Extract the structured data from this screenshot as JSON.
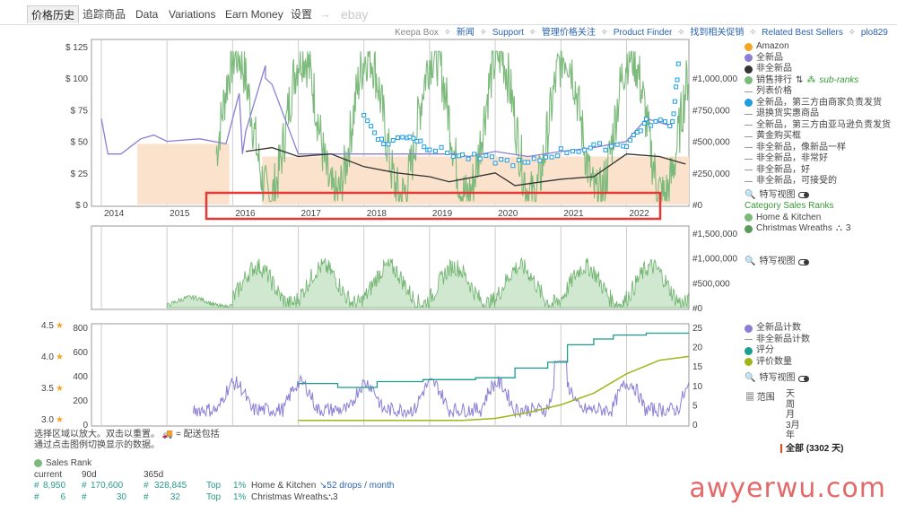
{
  "tabs": {
    "items": [
      "价格历史",
      "追踪商品",
      "Data",
      "Variations",
      "Earn Money",
      "设置",
      "→",
      "ebay"
    ]
  },
  "linkbar": {
    "keepa_box": "Keepa Box",
    "items": [
      "新闻",
      "Support",
      "管理价格关注",
      "Product Finder",
      "找到相关促销",
      "Related Best Sellers",
      "plo829"
    ],
    "sep": "✧"
  },
  "colors": {
    "amazon": "#f5a623",
    "new": "#8a7fd6",
    "used": "#333333",
    "sales_rank": "#7cba7c",
    "new_3rd_fba": "#1e9de0",
    "review_rating": "#1a9e8e",
    "review_count": "#a2b41a",
    "fill_orange": "#fbe2cc",
    "highlight": "#e53935"
  },
  "chart_data": [
    {
      "type": "line",
      "name": "main",
      "x_ticks": [
        "2014",
        "2015",
        "2016",
        "2017",
        "2018",
        "2019",
        "2020",
        "2021",
        "2022"
      ],
      "y_left_ticks": [
        "$ 0",
        "$ 25",
        "$ 50",
        "$ 75",
        "$ 100",
        "$ 125"
      ],
      "y_right_ticks": [
        "#0",
        "#250,000",
        "#500,000",
        "#750,000",
        "#1,000,000"
      ],
      "ylim_left": [
        0,
        125
      ],
      "ylim_right": [
        0,
        1250000
      ],
      "series": [
        {
          "name": "全新品",
          "values": [
            [
              2014.0,
              68
            ],
            [
              2014.1,
              40
            ],
            [
              2014.3,
              40
            ],
            [
              2014.6,
              52
            ],
            [
              2014.8,
              55
            ],
            [
              2015.0,
              50
            ],
            [
              2015.5,
              52
            ],
            [
              2015.9,
              48
            ],
            [
              2016.1,
              88
            ],
            [
              2016.15,
              40
            ],
            [
              2016.2,
              58
            ],
            [
              2016.5,
              110
            ],
            [
              2016.5,
              100
            ],
            [
              2016.6,
              95
            ],
            [
              2017.0,
              40
            ],
            [
              2018.5,
              40
            ],
            [
              2019.4,
              40
            ],
            [
              2019.6,
              38
            ],
            [
              2020.0,
              42
            ],
            [
              2020.5,
              38
            ],
            [
              2021.0,
              42
            ],
            [
              2021.5,
              45
            ],
            [
              2022.0,
              50
            ],
            [
              2022.3,
              68
            ],
            [
              2022.7,
              62
            ]
          ]
        },
        {
          "name": "非全新品",
          "values": [
            [
              2016.2,
              42
            ],
            [
              2016.6,
              45
            ],
            [
              2017.0,
              38
            ],
            [
              2017.5,
              40
            ],
            [
              2018.0,
              30
            ],
            [
              2018.5,
              25
            ],
            [
              2019.0,
              22
            ],
            [
              2019.3,
              18
            ],
            [
              2020.0,
              25
            ],
            [
              2020.3,
              15
            ],
            [
              2021.0,
              20
            ],
            [
              2021.5,
              22
            ],
            [
              2022.0,
              40
            ],
            [
              2022.5,
              38
            ],
            [
              2022.9,
              32
            ]
          ]
        },
        {
          "name": "全新品，第三方由商家负责发货",
          "values": [
            [
              2018.0,
              70
            ],
            [
              2018.3,
              48
            ],
            [
              2018.7,
              55
            ],
            [
              2019.0,
              45
            ],
            [
              2019.5,
              38
            ],
            [
              2020.0,
              35
            ],
            [
              2020.5,
              32
            ],
            [
              2021.0,
              42
            ],
            [
              2021.5,
              45
            ],
            [
              2022.0,
              48
            ],
            [
              2022.3,
              65
            ],
            [
              2022.7,
              65
            ],
            [
              2022.8,
              115
            ]
          ]
        }
      ],
      "highlight_box": {
        "from": "2016",
        "to": "2022"
      }
    },
    {
      "type": "area",
      "name": "category_sales_ranks",
      "y_right_ticks": [
        "#0",
        "#500,000",
        "#1,000,000",
        "#1,500,000"
      ],
      "ylim_right": [
        0,
        1500000
      ],
      "series": [
        {
          "name": "Home & Kitchen",
          "values": []
        },
        {
          "name": "Christmas Wreaths",
          "values": []
        }
      ]
    },
    {
      "type": "line",
      "name": "offers_and_reviews",
      "y_left_ticks": [
        "0",
        "200",
        "400",
        "600",
        "800"
      ],
      "y_right_ticks": [
        "0",
        "5",
        "10",
        "15",
        "20",
        "25"
      ],
      "y_star_ticks": [
        "3.0",
        "3.5",
        "4.0",
        "4.5"
      ],
      "ylim_left": [
        0,
        800
      ],
      "ylim_right": [
        0,
        25
      ],
      "series": [
        {
          "name": "全新品计数",
          "values": []
        },
        {
          "name": "评分",
          "values": []
        },
        {
          "name": "评价数量",
          "values": []
        }
      ]
    }
  ],
  "legend_main": {
    "amazon": "Amazon",
    "new": "全新品",
    "used": "非全新品",
    "sales_rank": "销售排行",
    "sub_ranks": "sub-ranks",
    "list_price": "列表价格",
    "new_3rd_fbm": "全新品，第三方由商家负责发货",
    "warehouse": "退换货实惠商品",
    "new_3rd_fba": "全新品，第三方由亚马逊负责发货",
    "buybox": "黄金购买框",
    "used_like_new": "非全新品，像新品一样",
    "used_very_good": "非全新品，非常好",
    "used_good": "非全新品，好",
    "used_acceptable": "非全新品，可接受的",
    "close_view": "特写视图"
  },
  "legend_cat": {
    "title": "Category Sales Ranks",
    "home": "Home & Kitchen",
    "wreaths": "Christmas Wreaths",
    "wreaths_count": "3",
    "close_view": "特写视图"
  },
  "legend_offers": {
    "new_count": "全新品计数",
    "used_count": "非全新品计数",
    "rating": "评分",
    "review_count": "评价数量",
    "close_view": "特写视图",
    "range": "范围",
    "range_options": [
      "天",
      "周",
      "月",
      "3月",
      "年"
    ],
    "all": "全部 (3302 天)"
  },
  "bottom": {
    "line1": "选择区域以放大。双击以重置。",
    "shipping": "= 配送包括",
    "line2": "通过点击图例切换显示的数据。"
  },
  "sales_rank_table": {
    "title": "Sales Rank",
    "headers": [
      "current",
      "90d",
      "365d"
    ],
    "rows": [
      {
        "current": "8,950",
        "d90": "170,600",
        "d365": "328,845",
        "top": "Top",
        "pct": "1%",
        "cat": "Home & Kitchen",
        "drops": "52 drops / month"
      },
      {
        "current": "6",
        "d90": "30",
        "d365": "32",
        "top": "Top",
        "pct": "1%",
        "cat": "Christmas Wreaths",
        "drops": "3"
      }
    ]
  },
  "watermark": "awyerwu.com"
}
